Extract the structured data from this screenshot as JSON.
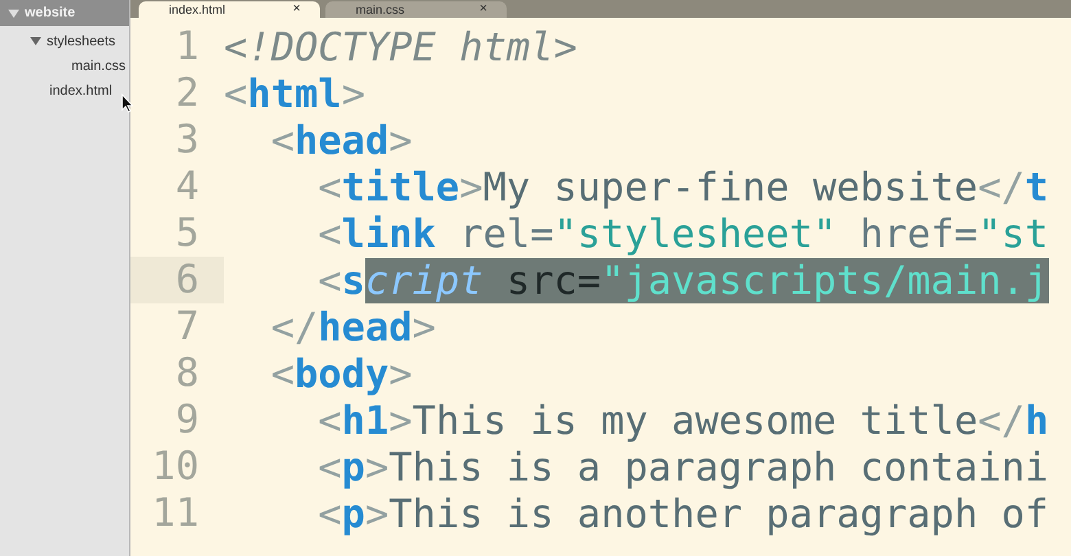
{
  "sidebar": {
    "root": {
      "label": "website",
      "expanded": true,
      "children": [
        {
          "label": "stylesheets",
          "expanded": true,
          "children": [
            {
              "label": "main.css",
              "selected": false
            }
          ]
        },
        {
          "label": "index.html",
          "selected": false
        }
      ]
    }
  },
  "tabs": [
    {
      "label": "index.html",
      "close": "×",
      "selected": true
    },
    {
      "label": "main.css",
      "close": "×",
      "selected": false
    }
  ],
  "lines": [
    {
      "number": "1",
      "current": false,
      "segments": [
        {
          "kind": "doctype",
          "text": "<!DOCTYPE html>"
        }
      ]
    },
    {
      "number": "2",
      "current": false,
      "segments": [
        {
          "kind": "punct",
          "text": "<"
        },
        {
          "kind": "tag",
          "text": "html"
        },
        {
          "kind": "punct",
          "text": ">"
        }
      ]
    },
    {
      "number": "3",
      "current": false,
      "segments": [
        {
          "kind": "punct",
          "text": "  <"
        },
        {
          "kind": "tag",
          "text": "head"
        },
        {
          "kind": "punct",
          "text": ">"
        }
      ]
    },
    {
      "number": "4",
      "current": false,
      "segments": [
        {
          "kind": "punct",
          "text": "    <"
        },
        {
          "kind": "tag",
          "text": "title"
        },
        {
          "kind": "punct",
          "text": ">"
        },
        {
          "kind": "text",
          "text": "My super-fine website"
        },
        {
          "kind": "punct",
          "text": "</"
        },
        {
          "kind": "tag",
          "text": "t"
        }
      ]
    },
    {
      "number": "5",
      "current": false,
      "segments": [
        {
          "kind": "punct",
          "text": "    <"
        },
        {
          "kind": "tag",
          "text": "link"
        },
        {
          "kind": "attr",
          "text": " rel="
        },
        {
          "kind": "string",
          "text": "\"stylesheet\""
        },
        {
          "kind": "attr",
          "text": " href="
        },
        {
          "kind": "string",
          "text": "\"st"
        }
      ]
    },
    {
      "number": "6",
      "current": true,
      "segments": [
        {
          "kind": "punct",
          "text": "    <"
        },
        {
          "kind": "tag",
          "text": "s"
        },
        {
          "kind": "tag",
          "text": "cript",
          "selected": true
        },
        {
          "kind": "attr",
          "text": " src=",
          "selected": true
        },
        {
          "kind": "string",
          "text": "\"javascripts/main.j",
          "selected": true
        }
      ]
    },
    {
      "number": "7",
      "current": false,
      "segments": [
        {
          "kind": "punct",
          "text": "  </"
        },
        {
          "kind": "tag",
          "text": "head"
        },
        {
          "kind": "punct",
          "text": ">"
        }
      ]
    },
    {
      "number": "8",
      "current": false,
      "segments": [
        {
          "kind": "punct",
          "text": "  <"
        },
        {
          "kind": "tag",
          "text": "body"
        },
        {
          "kind": "punct",
          "text": ">"
        }
      ]
    },
    {
      "number": "9",
      "current": false,
      "segments": [
        {
          "kind": "punct",
          "text": "    <"
        },
        {
          "kind": "tag",
          "text": "h1"
        },
        {
          "kind": "punct",
          "text": ">"
        },
        {
          "kind": "text",
          "text": "This is my awesome title"
        },
        {
          "kind": "punct",
          "text": "</"
        },
        {
          "kind": "tag",
          "text": "h"
        }
      ]
    },
    {
      "number": "10",
      "current": false,
      "segments": [
        {
          "kind": "punct",
          "text": "    <"
        },
        {
          "kind": "tag",
          "text": "p"
        },
        {
          "kind": "punct",
          "text": ">"
        },
        {
          "kind": "text",
          "text": "This is a paragraph containi"
        }
      ]
    },
    {
      "number": "11",
      "current": false,
      "segments": [
        {
          "kind": "punct",
          "text": "    <"
        },
        {
          "kind": "tag",
          "text": "p"
        },
        {
          "kind": "punct",
          "text": ">"
        },
        {
          "kind": "text",
          "text": "This is another paragraph of"
        }
      ]
    }
  ]
}
